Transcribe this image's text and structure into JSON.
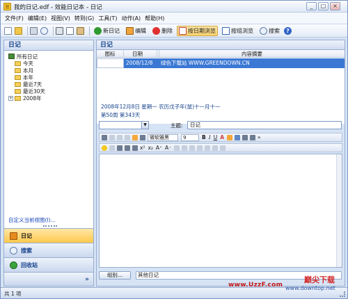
{
  "window": {
    "title": "我的日记.edf - 效能日记本 - 日记"
  },
  "menubar": {
    "items": [
      "文件(F)",
      "编辑(E)",
      "视图(V)",
      "转到(G)",
      "工具(T)",
      "动作(A)",
      "帮助(H)"
    ]
  },
  "toolbar": {
    "new_diary": "新日记",
    "edit": "编辑",
    "delete": "删除",
    "by_date": "按日期浏览",
    "by_group": "按组浏览",
    "search": "搜索"
  },
  "left_pane": {
    "title": "日记",
    "tree": [
      {
        "label": "所有日记",
        "level": 0,
        "icon": "book-icon"
      },
      {
        "label": "今天",
        "level": 1,
        "icon": "folder-icon"
      },
      {
        "label": "本月",
        "level": 1,
        "icon": "folder-icon"
      },
      {
        "label": "本年",
        "level": 1,
        "icon": "folder-icon"
      },
      {
        "label": "最近7天",
        "level": 1,
        "icon": "folder-icon"
      },
      {
        "label": "最近30天",
        "level": 1,
        "icon": "folder-icon"
      },
      {
        "label": "2008年",
        "level": 1,
        "icon": "folder-icon",
        "expandable": true
      }
    ],
    "custom_view": "自定义当前视图(I)...",
    "nav": {
      "diary": "日记",
      "search": "搜索",
      "recycle": "回收站"
    }
  },
  "right_pane": {
    "title": "日记",
    "grid": {
      "columns": [
        "图标",
        "日期",
        "内容摘要"
      ],
      "rows": [
        {
          "date": "2008/12/8",
          "summary": "绿色下载站 WWW.GREENDOWN.CN",
          "selected": true
        }
      ]
    },
    "date_info": "2008年12月8日 星期一 农历戊子年(鼠)十一月十一",
    "week_info": "第50周 第343天",
    "subject_label": "主题:",
    "subject_value": "日记",
    "font_name": "微软雅黑",
    "font_size": "9",
    "group_button": "组别...",
    "group_value": "其他日记"
  },
  "statusbar": {
    "text": "共 1 项"
  },
  "watermark": {
    "site1": "www.UzzF.com",
    "site2": "巅尖下载",
    "site3": "www.downtop.net"
  },
  "colors": {
    "selection": "#3a78d4",
    "accent_title": "#15428b",
    "active_nav": "#ffc94d"
  }
}
